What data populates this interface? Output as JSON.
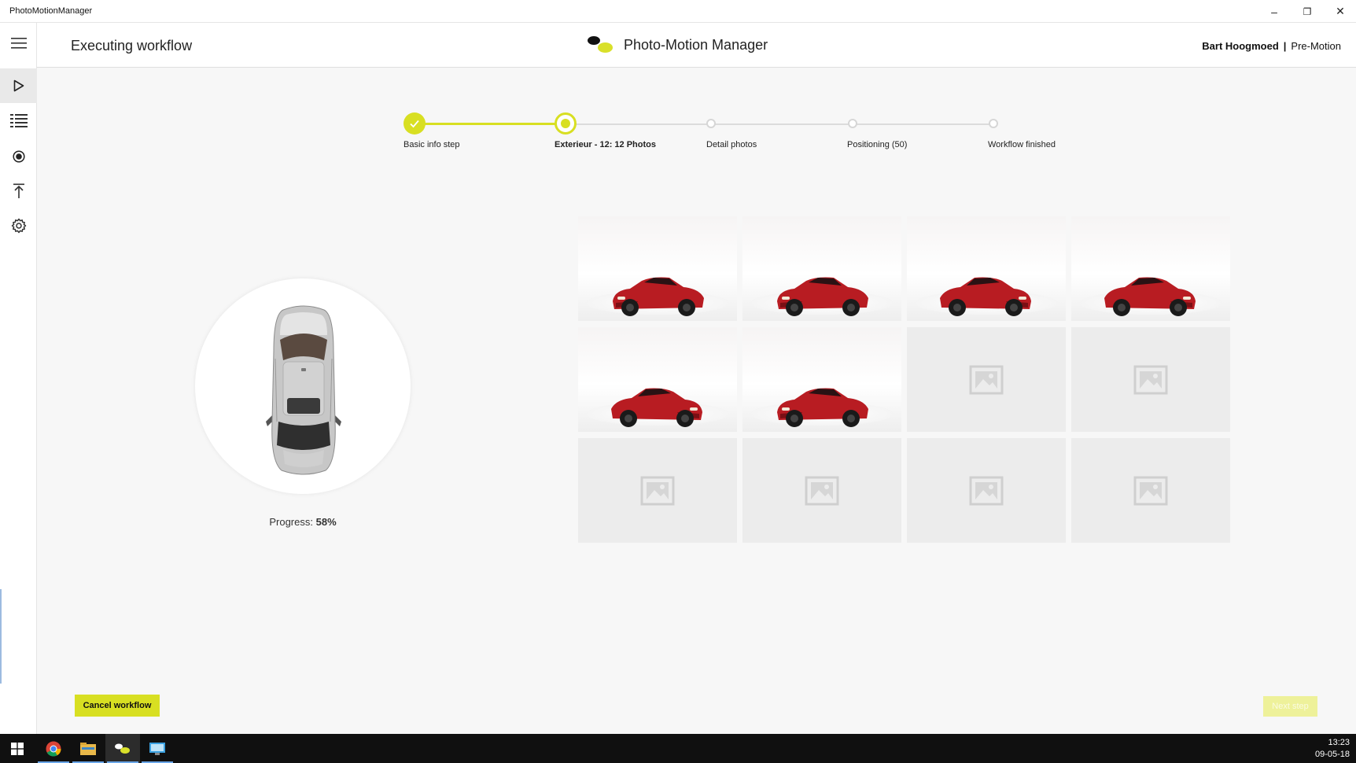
{
  "window": {
    "title": "PhotoMotionManager",
    "controls": {
      "minimize": "–",
      "maximize": "❐",
      "close": "✕"
    }
  },
  "header": {
    "page_title": "Executing workflow",
    "brand_name": "Photo-Motion Manager",
    "user_name": "Bart Hoogmoed",
    "separator": "|",
    "company": "Pre-Motion"
  },
  "sidebar": {
    "items": [
      {
        "name": "menu",
        "icon": "hamburger-icon"
      },
      {
        "name": "execute",
        "icon": "play-icon",
        "active": true
      },
      {
        "name": "workflows",
        "icon": "list-icon"
      },
      {
        "name": "record",
        "icon": "record-icon"
      },
      {
        "name": "upload",
        "icon": "upload-icon"
      },
      {
        "name": "settings",
        "icon": "gear-icon"
      }
    ]
  },
  "stepper": {
    "steps": [
      {
        "label": "Basic info step",
        "state": "done"
      },
      {
        "label": "Exterieur - 12: 12 Photos",
        "state": "current"
      },
      {
        "label": "Detail photos",
        "state": "pending"
      },
      {
        "label": "Positioning (50)",
        "state": "pending"
      },
      {
        "label": "Workflow finished",
        "state": "pending"
      }
    ]
  },
  "progress": {
    "label": "Progress:",
    "value": "58%"
  },
  "photos": {
    "captured": 6,
    "total": 12
  },
  "buttons": {
    "cancel": "Cancel workflow",
    "next": "Next step"
  },
  "colors": {
    "accent": "#d8df22",
    "accent_disabled": "#eef19a",
    "car_paint": "#b81c22"
  },
  "taskbar": {
    "apps": [
      "windows-start-icon",
      "chrome-icon",
      "file-explorer-icon",
      "photo-motion-manager-icon",
      "remote-desktop-icon"
    ],
    "time": "13:23",
    "date": "09-05-18"
  }
}
